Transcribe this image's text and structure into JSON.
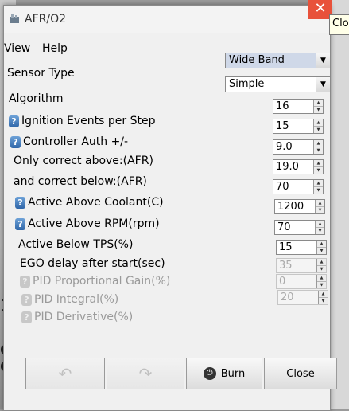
{
  "window": {
    "title": "AFR/O2"
  },
  "close_tooltip": "Close",
  "menu": {
    "view": "View",
    "help": "Help"
  },
  "fields": {
    "sensor_type": {
      "label": "Sensor Type",
      "value": "Wide Band"
    },
    "algorithm": {
      "label": "Algorithm",
      "value": "Simple"
    },
    "ignition_events": {
      "label": "Ignition Events per Step",
      "value": "16"
    },
    "controller_auth": {
      "label": "Controller Auth +/-",
      "value": "15"
    },
    "only_correct_above": {
      "label": "Only correct above:(AFR)",
      "value": "9.0"
    },
    "correct_below": {
      "label": "and correct below:(AFR)",
      "value": "19.0"
    },
    "active_above_coolant": {
      "label": "Active Above Coolant(C)",
      "value": "70"
    },
    "active_above_rpm": {
      "label": "Active Above RPM(rpm)",
      "value": "1200"
    },
    "active_below_tps": {
      "label": "Active Below TPS(%)",
      "value": "70"
    },
    "ego_delay": {
      "label": "EGO delay after start(sec)",
      "value": "15"
    },
    "pid_proportional": {
      "label": "PID Proportional Gain(%)",
      "value": "35"
    },
    "pid_integral": {
      "label": "PID Integral(%)",
      "value": "0"
    },
    "pid_derivative": {
      "label": "PID Derivative(%)",
      "value": "20"
    }
  },
  "buttons": {
    "burn": "Burn",
    "close": "Close"
  },
  "icons": {
    "help": "help-icon",
    "undo": "undo-icon",
    "redo": "redo-icon",
    "burn": "power-icon"
  }
}
